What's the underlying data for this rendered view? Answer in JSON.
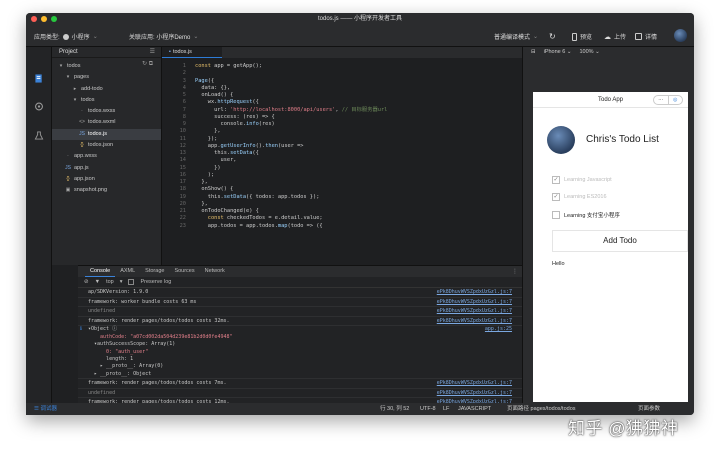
{
  "window": {
    "title": "todos.js —— 小程序开发者工具",
    "traffic_colors": [
      "#ff5f56",
      "#ffbd2e",
      "#27c93f"
    ]
  },
  "toolbar": {
    "app_type_label": "应用类型:",
    "app_type_value": "小程序",
    "linked_app_label": "关联应用: 小程序Demo",
    "compile_mode": "普通编译模式",
    "preview_label": "预览",
    "upload_label": "上传",
    "detail_label": "详情"
  },
  "project": {
    "title": "Project",
    "tree": [
      {
        "label": "todos",
        "indent": 0,
        "icon": "▾"
      },
      {
        "label": "pages",
        "indent": 1,
        "icon": "▾"
      },
      {
        "label": "add-todo",
        "indent": 2,
        "icon": "▸"
      },
      {
        "label": "todos",
        "indent": 2,
        "icon": "▾"
      },
      {
        "label": "todos.wxss",
        "indent": 3,
        "icon": "·"
      },
      {
        "label": "todos.wxml",
        "indent": 3,
        "icon": "<>"
      },
      {
        "label": "todos.js",
        "indent": 3,
        "icon": "JS",
        "selected": true
      },
      {
        "label": "todos.json",
        "indent": 3,
        "icon": "{}"
      },
      {
        "label": "app.wxss",
        "indent": 1,
        "icon": "·"
      },
      {
        "label": "app.js",
        "indent": 1,
        "icon": "JS"
      },
      {
        "label": "app.json",
        "indent": 1,
        "icon": "{}"
      },
      {
        "label": "snapshot.png",
        "indent": 1,
        "icon": "▣"
      }
    ]
  },
  "editor": {
    "tab_label": "todos.js",
    "lines": [
      {
        "n": "1",
        "html": "<span class=\"kw\">const</span> <span class=\"pl\">app = getApp();</span>"
      },
      {
        "n": "2",
        "html": ""
      },
      {
        "n": "3",
        "html": "<span class=\"fn\">Page</span><span class=\"pl\">({</span>"
      },
      {
        "n": "4",
        "html": "<span class=\"pl\">  data: {},</span>"
      },
      {
        "n": "5",
        "html": "<span class=\"pl\">  onLoad() {</span>"
      },
      {
        "n": "6",
        "html": "<span class=\"pl\">    wx.</span><span class=\"fn\">httpRequest</span><span class=\"pl\">({</span>"
      },
      {
        "n": "7",
        "html": "<span class=\"pl\">      url: </span><span class=\"str\">'http://localhost:8000/api/users'</span><span class=\"pl\">, </span><span class=\"cm\">// 目标服务器url</span>"
      },
      {
        "n": "8",
        "html": "<span class=\"pl\">      success: (res) => {</span>"
      },
      {
        "n": "9",
        "html": "<span class=\"pl\">        console.</span><span class=\"fn\">info</span><span class=\"pl\">(res)</span>"
      },
      {
        "n": "10",
        "html": "<span class=\"pl\">      },</span>"
      },
      {
        "n": "11",
        "html": "<span class=\"pl\">    });</span>"
      },
      {
        "n": "12",
        "html": "<span class=\"pl\">    app.</span><span class=\"fn\">getUserInfo</span><span class=\"pl\">().</span><span class=\"fn\">then</span><span class=\"pl\">(user =></span>"
      },
      {
        "n": "13",
        "html": "<span class=\"pl\">      this.</span><span class=\"fn\">setData</span><span class=\"pl\">({</span>"
      },
      {
        "n": "14",
        "html": "<span class=\"pl\">        user,</span>"
      },
      {
        "n": "15",
        "html": "<span class=\"pl\">      })</span>"
      },
      {
        "n": "16",
        "html": "<span class=\"pl\">    );</span>"
      },
      {
        "n": "17",
        "html": "<span class=\"pl\">  },</span>"
      },
      {
        "n": "18",
        "html": "<span class=\"pl\">  onShow() {</span>"
      },
      {
        "n": "19",
        "html": "<span class=\"pl\">    this.</span><span class=\"fn\">setData</span><span class=\"pl\">({ todos: app.todos });</span>"
      },
      {
        "n": "20",
        "html": "<span class=\"pl\">  },</span>"
      },
      {
        "n": "21",
        "html": "<span class=\"pl\">  onTodoChanged(e) {</span>"
      },
      {
        "n": "22",
        "html": "<span class=\"pl\">    </span><span class=\"kw\">const</span><span class=\"pl\"> checkedTodos = e.detail.value;</span>"
      },
      {
        "n": "23",
        "html": "<span class=\"pl\">    app.todos = app.todos.</span><span class=\"fn\">map</span><span class=\"pl\">(todo => ({</span>"
      }
    ]
  },
  "console": {
    "tabs": [
      "Console",
      "AXML",
      "Storage",
      "Sources",
      "Network"
    ],
    "active_tab": "Console",
    "filter_top": "top",
    "preserve_log": "Preserve log",
    "src_link": "ePk8DhuvWVSZpdxUzGzl.js:7",
    "obj_src": "app.js:25",
    "rows_before": [
      "ap/SDKVersion: 1.9.0",
      "framework: worker bundle costs 63 ms",
      "undefined",
      "framework: render pages/todos/todos costs 32ms."
    ],
    "object_lines": [
      "▾Object ⓘ",
      "    authCode: \"a07cd002da504d239e81b2d0d0fe4948\"",
      "  ▾authSuccessScope: Array(1)",
      "      0: \"auth_user\"",
      "      length: 1",
      "    ▸ __proto__: Array(0)",
      "  ▸ __proto__: Object"
    ],
    "rows_after": [
      "framework: render pages/todos/todos costs 7ms.",
      "undefined",
      "framework: render pages/todos/todos costs 12ms."
    ]
  },
  "statusbar": {
    "debug_label": "调试器",
    "position": "行 30, 列 52",
    "encoding": "UTF-8",
    "eol": "LF",
    "language": "JAVASCRIPT",
    "page_path_label": "页面路径",
    "page_path": "pages/todos/todos",
    "page_params": "页面参数"
  },
  "simulator": {
    "device": "iPhone 6",
    "zoom": "100%",
    "nav_title": "Todo App",
    "user_name": "Chris's Todo List",
    "todos": [
      {
        "text": "Learning Javascript",
        "done": true
      },
      {
        "text": "Learning ES2016",
        "done": true
      },
      {
        "text": "Learning 支付宝小程序",
        "done": false
      }
    ],
    "add_button": "Add Todo",
    "hello": "Hello"
  },
  "watermark": "知乎 @狒狒神"
}
